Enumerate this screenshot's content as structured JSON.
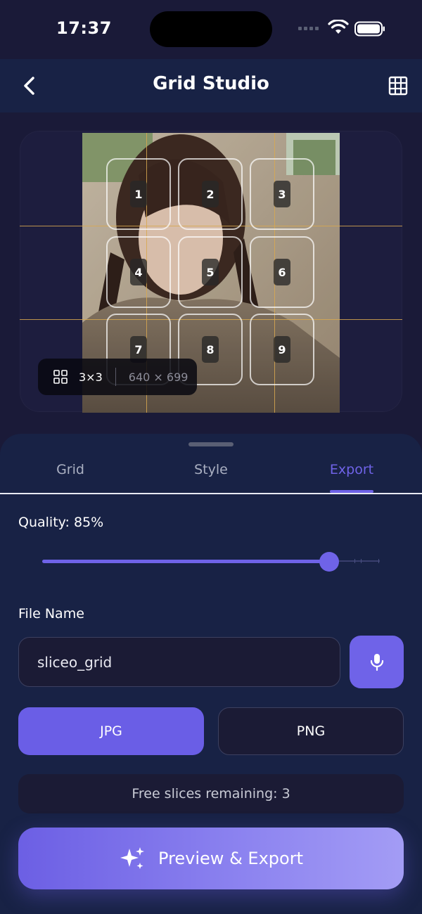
{
  "status_bar": {
    "time": "17:37"
  },
  "header": {
    "title": "Grid Studio",
    "back_icon": "chevron-left-icon",
    "action_icon": "grid-icon"
  },
  "preview": {
    "tiles": [
      "1",
      "2",
      "3",
      "4",
      "5",
      "6",
      "7",
      "8",
      "9"
    ],
    "grid_size": "3×3",
    "dimensions": "640 × 699",
    "guide_color": "#d8a850"
  },
  "tabs": [
    {
      "label": "Grid",
      "active": false
    },
    {
      "label": "Style",
      "active": false
    },
    {
      "label": "Export",
      "active": true
    }
  ],
  "export": {
    "quality_label": "Quality: 85%",
    "quality_value": 0.85,
    "file_name_label": "File Name",
    "file_name_value": "sliceo_grid",
    "formats": [
      {
        "label": "JPG",
        "selected": true
      },
      {
        "label": "PNG",
        "selected": false
      }
    ],
    "free_slices": "Free slices remaining: 3",
    "export_button": "Preview & Export"
  },
  "colors": {
    "accent": "#6f63e8",
    "background": "#1a1a38",
    "sheet": "#182245"
  }
}
